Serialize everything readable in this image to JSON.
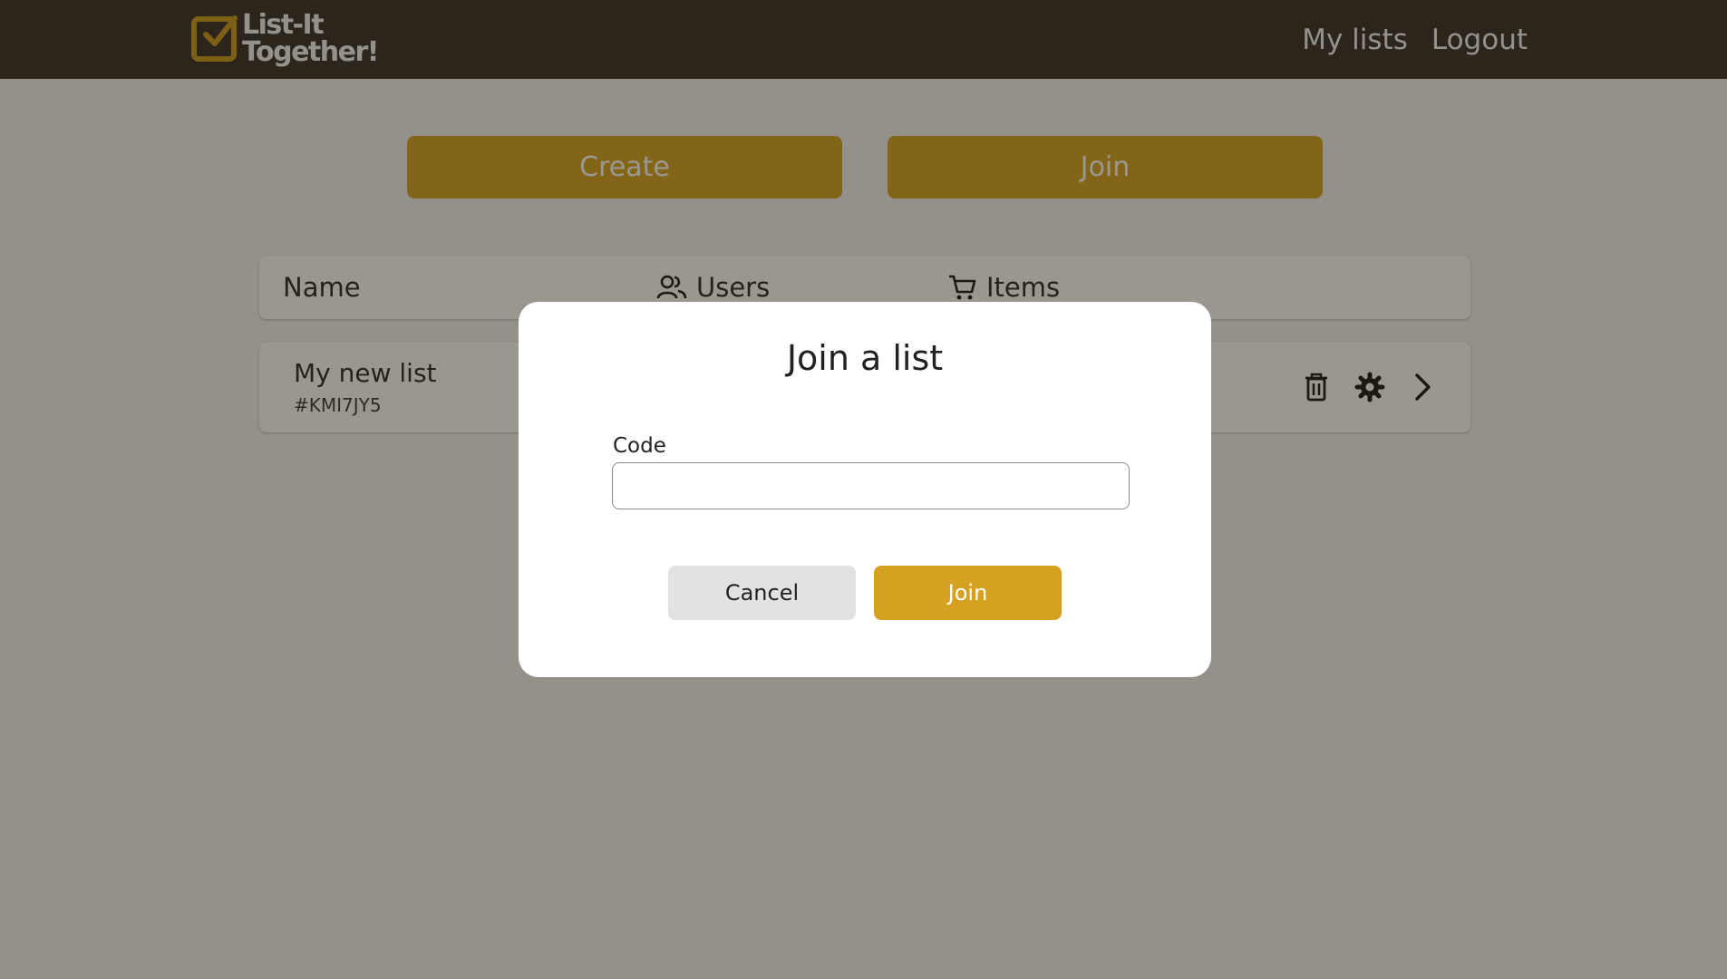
{
  "brand": {
    "line1": "List-It",
    "line2": "Together!"
  },
  "nav": {
    "my_lists": "My lists",
    "logout": "Logout"
  },
  "actions": {
    "create": "Create",
    "join": "Join"
  },
  "table": {
    "headers": {
      "name": "Name",
      "users": "Users",
      "items": "Items"
    },
    "rows": [
      {
        "name": "My new list",
        "code": "#KMI7JY5"
      }
    ]
  },
  "modal": {
    "title": "Join a list",
    "code_label": "Code",
    "code_value": "",
    "cancel": "Cancel",
    "join": "Join"
  },
  "colors": {
    "navbar": "#2e2924",
    "accent": "#d6a021",
    "cancel_bg": "#e2e2e2",
    "background": "#f4f4f4"
  },
  "icons": {
    "users": "users-icon",
    "items": "cart-icon",
    "delete": "trash-icon",
    "settings": "gear-icon",
    "open": "chevron-right-icon",
    "logo": "checkbox-logo-icon"
  }
}
